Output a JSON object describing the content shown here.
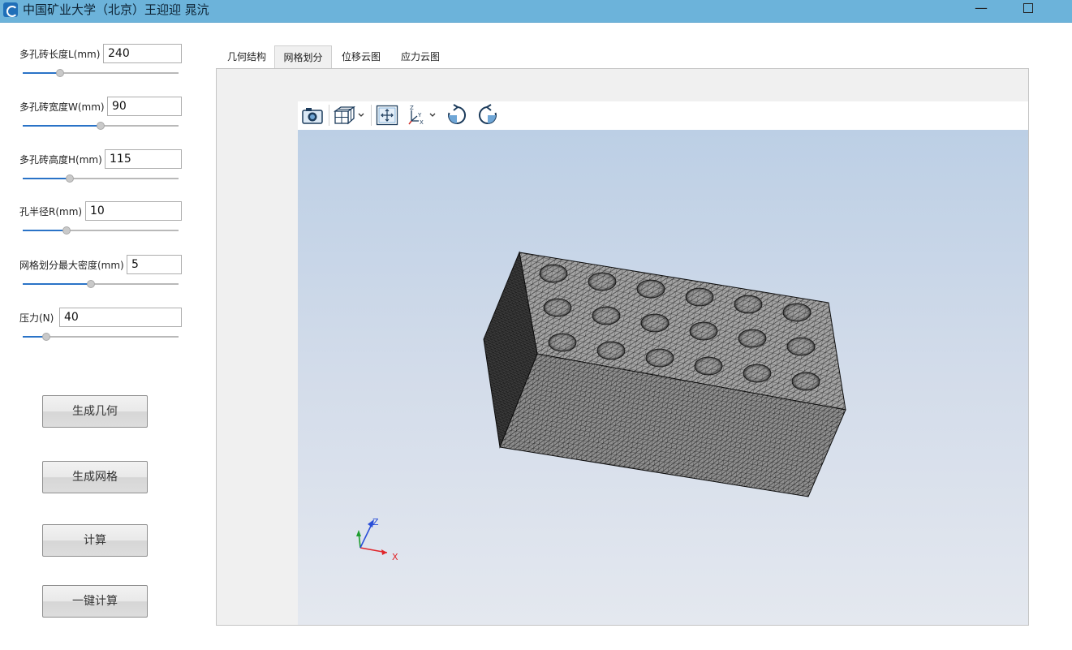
{
  "window": {
    "title": "中国矿业大学（北京）王迎迎 晁沆",
    "minimize_glyph": "—",
    "maximize_glyph": ""
  },
  "params": [
    {
      "label": "多孔砖长度L(mm)",
      "value": "240",
      "slider_fraction": 0.24
    },
    {
      "label": "多孔砖宽度W(mm)",
      "value": "90",
      "slider_fraction": 0.5
    },
    {
      "label": "多孔砖高度H(mm)",
      "value": "115",
      "slider_fraction": 0.3
    },
    {
      "label": "孔半径R(mm)",
      "value": "10",
      "slider_fraction": 0.28
    },
    {
      "label": "网格划分最大密度(mm)",
      "value": "5",
      "slider_fraction": 0.44
    },
    {
      "label": "压力(N)",
      "value": "40",
      "slider_fraction": 0.15
    }
  ],
  "actions": {
    "generate_geometry": "生成几何",
    "generate_mesh": "生成网格",
    "compute": "计算",
    "one_click_compute": "一键计算"
  },
  "tabs": [
    {
      "label": "几何结构",
      "active": false
    },
    {
      "label": "网格划分",
      "active": true
    },
    {
      "label": "位移云图",
      "active": false
    },
    {
      "label": "应力云图",
      "active": false
    }
  ],
  "viewer": {
    "toolbar_icons": [
      "camera-icon",
      "view-cube-icon",
      "chevron-down-icon",
      "fit-view-icon",
      "axes-icon",
      "chevron-down-icon",
      "rotate-cw-icon",
      "rotate-ccw-icon"
    ],
    "axes": {
      "x": "X",
      "y": "Y",
      "z": "Z"
    },
    "axis_colors": {
      "x": "#e0262b",
      "y": "#1e9e2e",
      "z": "#2a4fd8"
    },
    "background_top": "#bccfe5",
    "background_bottom": "#e4e8ef",
    "mesh_face_color": "#9a9a9a",
    "mesh_line_color": "#151515"
  },
  "colors": {
    "titlebar": "#6cb3da",
    "slider_fill": "#2a73c7"
  }
}
